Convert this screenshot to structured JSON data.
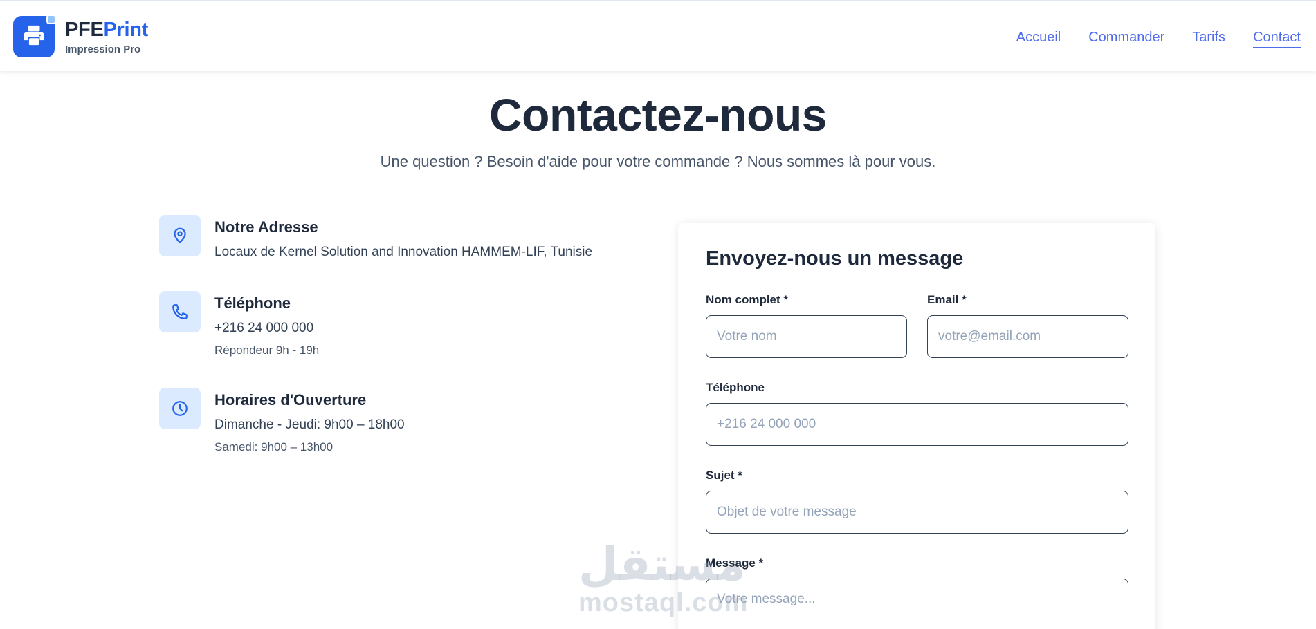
{
  "header": {
    "brand_part1": "PFE",
    "brand_part2": "Print",
    "brand_sub": "Impression Pro",
    "nav": [
      {
        "label": "Accueil",
        "active": false
      },
      {
        "label": "Commander",
        "active": false
      },
      {
        "label": "Tarifs",
        "active": false
      },
      {
        "label": "Contact",
        "active": true
      }
    ]
  },
  "hero": {
    "title": "Contactez-nous",
    "subtitle": "Une question ? Besoin d'aide pour votre commande ? Nous sommes là pour vous."
  },
  "info": {
    "address": {
      "icon": "map-pin-icon",
      "title": "Notre Adresse",
      "line": "Locaux de Kernel Solution and Innovation HAMMEM-LIF, Tunisie"
    },
    "phone": {
      "icon": "phone-icon",
      "title": "Téléphone",
      "line": "+216 24 000 000",
      "note": "Répondeur 9h - 19h"
    },
    "hours": {
      "icon": "clock-icon",
      "title": "Horaires d'Ouverture",
      "line": "Dimanche - Jeudi: 9h00 – 18h00",
      "note": "Samedi: 9h00 – 13h00"
    }
  },
  "form": {
    "title": "Envoyez-nous un message",
    "name": {
      "label": "Nom complet *",
      "placeholder": "Votre nom",
      "value": ""
    },
    "email": {
      "label": "Email *",
      "placeholder": "votre@email.com",
      "value": ""
    },
    "phone": {
      "label": "Téléphone",
      "placeholder": "+216 24 000 000",
      "value": ""
    },
    "subject": {
      "label": "Sujet *",
      "placeholder": "Objet de votre message",
      "value": ""
    },
    "message": {
      "label": "Message *",
      "placeholder": "Votre message...",
      "value": ""
    }
  },
  "watermark": {
    "arabic": "مستقل",
    "latin": "mostaql.com"
  },
  "colors": {
    "primary": "#2563eb",
    "nav_link": "#4f6bed",
    "heading": "#1e293b",
    "icon_bg": "#dbeafe"
  }
}
